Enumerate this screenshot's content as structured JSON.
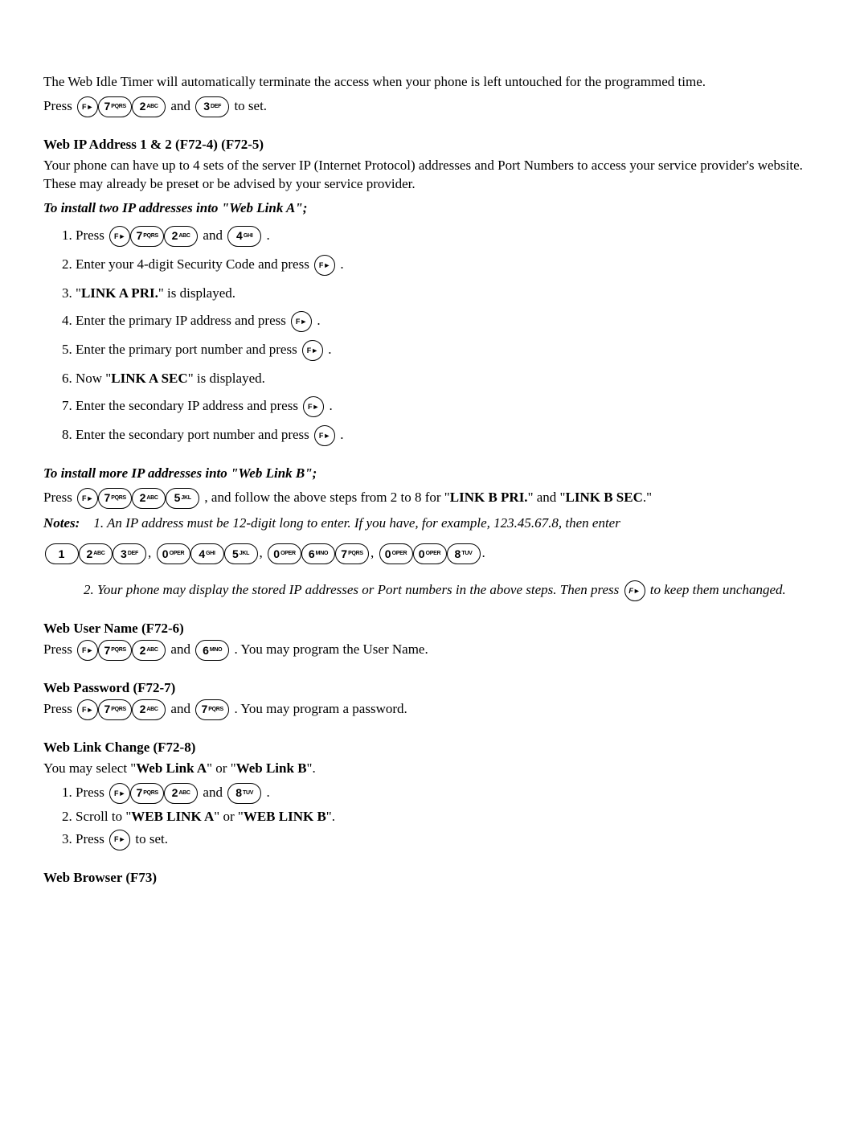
{
  "keys": {
    "fn": "F►",
    "k0": {
      "n": "0",
      "t": "OPER"
    },
    "k1": {
      "n": "1",
      "t": ""
    },
    "k2": {
      "n": "2",
      "t": "ABC"
    },
    "k3": {
      "n": "3",
      "t": "DEF"
    },
    "k4": {
      "n": "4",
      "t": "GHI"
    },
    "k5": {
      "n": "5",
      "t": "JKL"
    },
    "k6": {
      "n": "6",
      "t": "MNO"
    },
    "k7": {
      "n": "7",
      "t": "PQRS"
    },
    "k8": {
      "n": "8",
      "t": "TUV"
    }
  },
  "t": {
    "intro": "The Web Idle Timer will automatically terminate the access when your phone is left untouched for the programmed time.",
    "press": "Press ",
    "and": " and ",
    "to_set": " to set.",
    "h_ip": "Web IP Address 1 & 2 (F72-4) (F72-5)",
    "ip_body": "Your phone can have up to 4 sets of the server IP (Internet Protocol) addresses and Port Numbers to access your service provider's website.  These may already be preset or be advised by your service provider.",
    "install_a": "To install two IP addresses into \"Web Link A\";",
    "s1a": "Press ",
    "s1b": ".",
    "s2a": "Enter your 4-digit Security Code and press ",
    "s2b": ".",
    "s3a": "\"",
    "s3bold": "LINK A PRI.",
    "s3b": "\" is displayed.",
    "s4a": "Enter the primary IP address and press ",
    "s4b": ".",
    "s5a": "Enter the primary port number and press ",
    "s5b": ".",
    "s6a": "Now \"",
    "s6bold": "LINK A SEC",
    "s6b": "\" is displayed.",
    "s7a": "Enter the secondary IP address and press ",
    "s7b": ".",
    "s8a": "Enter the secondary port number and press ",
    "s8b": ".",
    "install_b": "To install more IP addresses into \"Web Link B\";",
    "lb1": ", and follow the above steps from 2 to 8 for \"",
    "lb2": "LINK B PRI.",
    "lb3": "\" and \"",
    "lb4": "LINK B SEC",
    "lb5": ".\"",
    "notes": "Notes:",
    "n1": "1.  An IP address must be 12-digit long to enter.   If you have, for example, 123.45.67.8, then enter",
    "comma": ", ",
    "dot": ".",
    "n2a": "2.  Your phone may display the stored IP addresses or Port numbers in the above steps.  Then press ",
    "n2b": " to keep them unchanged.",
    "h_user": "Web User Name (F72-6)",
    "user_tail": ".  You may program the User Name.",
    "h_pass": "Web Password (F72-7)",
    "pass_tail": ".  You may program a password.",
    "h_link": "Web Link Change (F72-8)",
    "link_body_a": "You may select \"",
    "link_body_b": "Web Link A",
    "link_body_c": "\" or \"",
    "link_body_d": "Web Link B",
    "link_body_e": "\".",
    "lc2a": "Scroll to \"",
    "lc2b": "WEB LINK A",
    "lc2c": "\" or \"",
    "lc2d": "WEB LINK B",
    "lc2e": "\".",
    "lc3a": "Press ",
    "lc3b": " to set.",
    "h_browser": "Web Browser (F73)"
  }
}
